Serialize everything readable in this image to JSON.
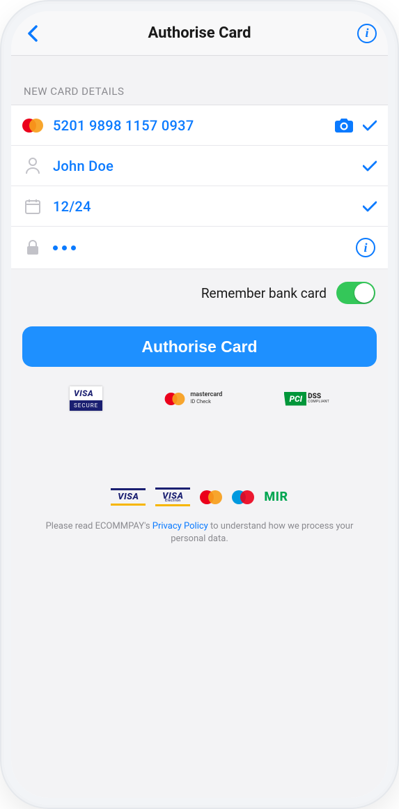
{
  "header": {
    "title": "Authorise Card"
  },
  "section": {
    "title": "NEW CARD DETAILS"
  },
  "card": {
    "number": "5201 9898 1157 0937",
    "holder": "John Doe",
    "expiry": "12/24",
    "cvv_masked": "•••"
  },
  "remember": {
    "label": "Remember bank card",
    "on": true
  },
  "cta": {
    "label": "Authorise Card"
  },
  "badges": {
    "visa_secure_top": "VISA",
    "visa_secure_bot": "SECURE",
    "mc_id_top": "mastercard",
    "mc_id_bot": "ID Check",
    "pci_flag": "PCI",
    "pci_dss": "DSS",
    "pci_sub": "COMPLIANT"
  },
  "networks": {
    "visa": "VISA",
    "visa_electron": "VISA",
    "visa_electron_sub": "Electron",
    "mir": "MIR"
  },
  "privacy": {
    "pre": "Please read ECOMMPAY's ",
    "link": "Privacy Policy",
    "post": " to understand how we process your personal data."
  }
}
